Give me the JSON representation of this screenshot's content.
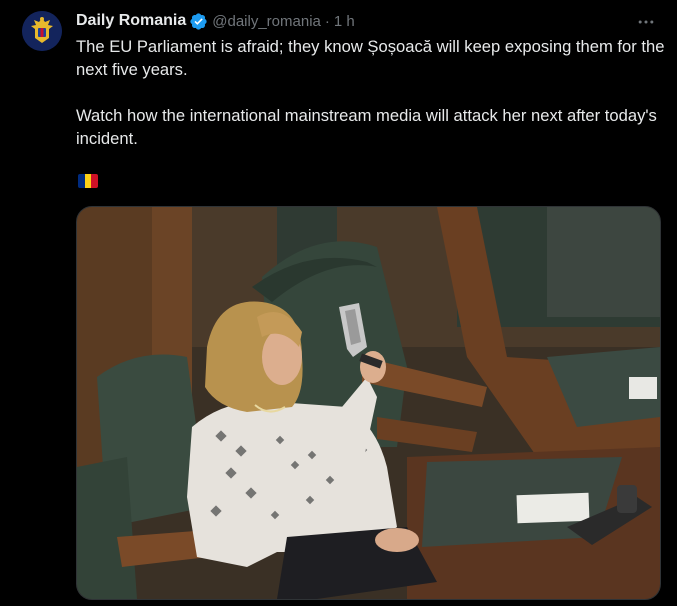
{
  "post": {
    "display_name": "Daily Romania",
    "handle": "@daily_romania",
    "separator": "·",
    "time": "1 h",
    "text_paragraph_1": "The EU Parliament is afraid; they know Șoșoacă will keep exposing them for the next five years.",
    "text_paragraph_2": "Watch how the international mainstream media will attack her next after today's incident.",
    "flag_emoji": "romania-flag",
    "media": {
      "image": "photo of a woman seated in a parliament chamber holding a pistol"
    }
  },
  "icons": {
    "verified": "verified-badge-icon",
    "more": "more-horizontal-icon",
    "avatar": "romania-coat-of-arms"
  },
  "colors": {
    "background": "#000000",
    "text_primary": "#e7e9ea",
    "text_secondary": "#71767b",
    "verified_blue": "#1d9bf0",
    "flag_blue": "#002b7f",
    "flag_yellow": "#fcd116",
    "flag_red": "#ce1126"
  }
}
